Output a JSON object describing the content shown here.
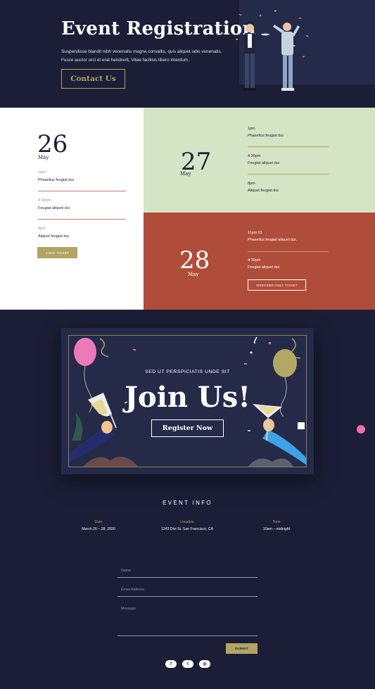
{
  "hero": {
    "title": "Event Registration",
    "description": "Suspendisse blandit nibh venenatis magna convallis, quis aliquet odio venenatis. Fusce auctor orci et erat hendrerit, Vitae facilisis libero interdum.",
    "button_label": "Contact Us"
  },
  "schedule": {
    "day1": {
      "day": "26",
      "month": "May",
      "slots": [
        {
          "time": "1pm",
          "text": "Phasellus feugiat dui"
        },
        {
          "time": "4:30pm",
          "text": "Feugiat aliquet dui"
        },
        {
          "time": "8pm",
          "text": "Aliquet feugiat dui"
        }
      ],
      "ticket_label": "1 DAY TICKET"
    },
    "day2": {
      "day": "27",
      "month": "May",
      "slots": [
        {
          "time": "1pm",
          "text": "Phasellus feugiat dui"
        },
        {
          "time": "4:30pm",
          "text": "Feugiat aliquet dui"
        },
        {
          "time": "8pm",
          "text": "Aliquet feugiat dui"
        }
      ]
    },
    "day3": {
      "day": "28",
      "month": "May",
      "slots": [
        {
          "time": "11pm 01",
          "text": "Phasellus feugiat aliquet dui."
        },
        {
          "time": "4:30pm",
          "text": "Feugiat aliquet dui"
        }
      ],
      "ticket_label": "WEEKEND ONLY TICKET"
    }
  },
  "join": {
    "subtitle": "SED UT PERSPICIATIS UNDE SIT",
    "title": "Join Us!",
    "button_label": "Register Now"
  },
  "event_info": {
    "title": "EVENT INFO",
    "columns": [
      {
        "label": "Date",
        "value": "March 26 – 28, 2020"
      },
      {
        "label": "Location",
        "value": "1243 Divi St. San Francisco, CA"
      },
      {
        "label": "Time",
        "value": "10am – midnight"
      }
    ]
  },
  "form": {
    "name_label": "Name",
    "email_label": "Email Address",
    "message_label": "Message",
    "submit_label": "SUBMIT"
  },
  "social": {
    "facebook": "f",
    "twitter": "t",
    "instagram": "◎"
  },
  "colors": {
    "background": "#1b1e36",
    "accent_gold": "#b2a463",
    "day2_green": "#d4e4c4",
    "day3_red": "#b04d3a",
    "pink": "#ef6fa6"
  },
  "icons": [
    "facebook-icon",
    "twitter-icon",
    "instagram-icon"
  ]
}
